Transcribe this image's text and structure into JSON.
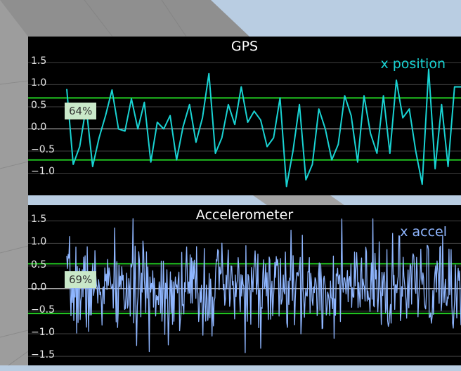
{
  "colors": {
    "background": "#b9cde2",
    "floor": "#9a9a9a",
    "panel": "#000000",
    "grid": "#404040",
    "zero_line": "#bbbbbb",
    "threshold": "#22cc22",
    "gps_series": "#19d3d3",
    "accel_series": "#8fb6ff",
    "percent_box": "#c9e8c9"
  },
  "chart_data": [
    {
      "type": "line",
      "title": "GPS",
      "legend_placement": "top-right",
      "grid": true,
      "ylim": [
        -1.5,
        1.8
      ],
      "yticks": [
        "1.5",
        "1.0",
        "0.5",
        "0.0",
        "−0.5",
        "−1.0"
      ],
      "threshold_lines": [
        0.7,
        -0.7
      ],
      "percent_label": "64%",
      "series": [
        {
          "name": "x position",
          "color": "#19d3d3",
          "values": [
            0.9,
            -0.8,
            -0.4,
            0.5,
            -0.85,
            -0.2,
            0.3,
            0.88,
            0.0,
            -0.05,
            0.68,
            0.0,
            0.6,
            -0.75,
            0.15,
            0.0,
            0.3,
            -0.7,
            0.05,
            0.55,
            -0.3,
            0.25,
            1.25,
            -0.55,
            -0.2,
            0.55,
            0.1,
            0.95,
            0.15,
            0.4,
            0.2,
            -0.4,
            -0.2,
            0.7,
            -1.3,
            -0.5,
            0.55,
            -1.15,
            -0.8,
            0.45,
            0.0,
            -0.7,
            -0.35,
            0.75,
            0.3,
            -0.75,
            0.75,
            -0.1,
            -0.55,
            0.75,
            -0.55,
            1.1,
            0.25,
            0.45,
            -0.5,
            -1.25,
            1.35,
            -0.9,
            0.55,
            -0.85,
            0.95,
            0.95
          ]
        }
      ]
    },
    {
      "type": "line",
      "title": "Accelerometer",
      "legend_placement": "top-right",
      "grid": true,
      "ylim": [
        -1.7,
        1.8
      ],
      "yticks": [
        "1.5",
        "1.0",
        "0.5",
        "0.0",
        "−0.5",
        "−1.0",
        "−1.5"
      ],
      "threshold_lines": [
        0.55,
        -0.55
      ],
      "percent_label": "69%",
      "series": [
        {
          "name": "x accel",
          "color": "#8fb6ff",
          "noise_std": 0.5,
          "seed": 7,
          "n_points": 560
        }
      ]
    }
  ]
}
